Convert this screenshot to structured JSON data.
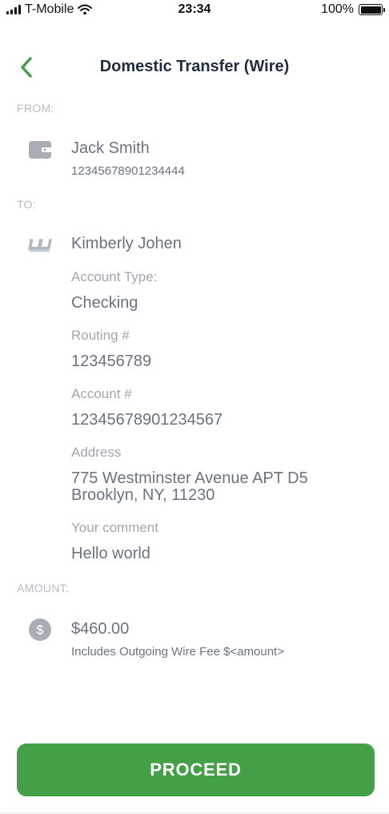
{
  "status_bar": {
    "carrier": "T-Mobile",
    "time": "23:34",
    "battery": "100%"
  },
  "header": {
    "title": "Domestic Transfer (Wire)"
  },
  "from": {
    "section_label": "FROM:",
    "name": "Jack Smith",
    "account_number": "12345678901234444"
  },
  "to": {
    "section_label": "TO:",
    "name": "Kimberly Johen",
    "fields": [
      {
        "label": "Account Type:",
        "value": "Checking"
      },
      {
        "label": "Routing #",
        "value": "123456789"
      },
      {
        "label": "Account #",
        "value": "12345678901234567"
      },
      {
        "label": "Address",
        "value_line1": "775 Westminster Avenue APT D5",
        "value_line2": "Brooklyn, NY, 11230"
      },
      {
        "label": "Your comment",
        "value": "Hello world"
      }
    ]
  },
  "amount": {
    "section_label": "AMOUNT:",
    "value": "$460.00",
    "note": "Includes Outgoing Wire Fee $<amount>"
  },
  "proceed_label": "PROCEED",
  "colors": {
    "accent": "#43a047",
    "title": "#1f2d3d",
    "text": "#6b7280",
    "muted": "#b7bcc3"
  },
  "icons": {
    "back": "chevron-left-icon",
    "wallet": "wallet-icon",
    "payee": "bank-logo-icon",
    "dollar": "dollar-icon"
  }
}
